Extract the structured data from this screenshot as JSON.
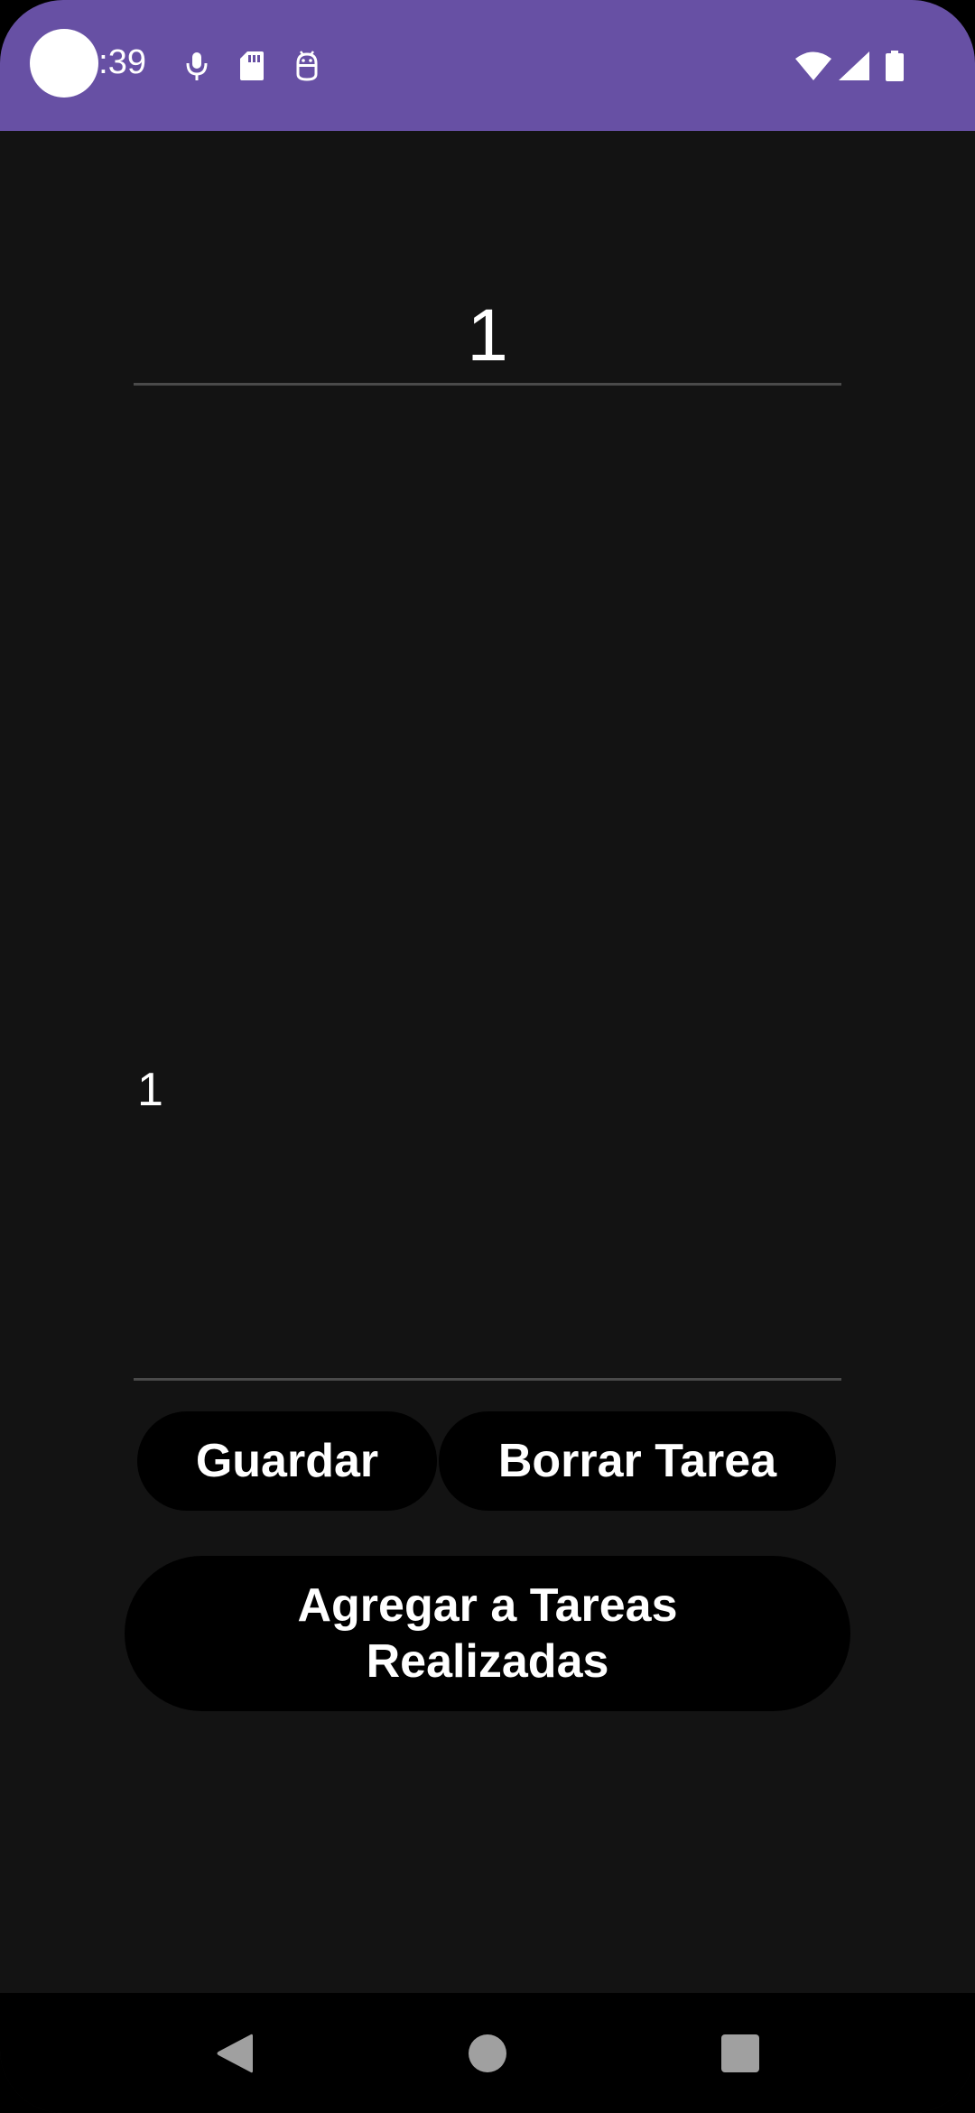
{
  "status_bar": {
    "time": "3:39",
    "icons": [
      "camera-cutout-icon",
      "microphone-icon",
      "sd-card-icon",
      "android-debug-icon",
      "wifi-icon",
      "cellular-signal-icon",
      "battery-icon"
    ],
    "background_color": "#6750a4"
  },
  "task": {
    "title_value": "1",
    "body_value": "1"
  },
  "actions": {
    "save_label": "Guardar",
    "delete_label": "Borrar Tarea",
    "mark_done_label": "Agregar a Tareas Realizadas"
  },
  "navigation": {
    "icons": [
      "back-icon",
      "home-icon",
      "recents-icon"
    ]
  },
  "colors": {
    "screen_background": "#131313",
    "button_background": "#000000",
    "text": "#ffffff"
  }
}
